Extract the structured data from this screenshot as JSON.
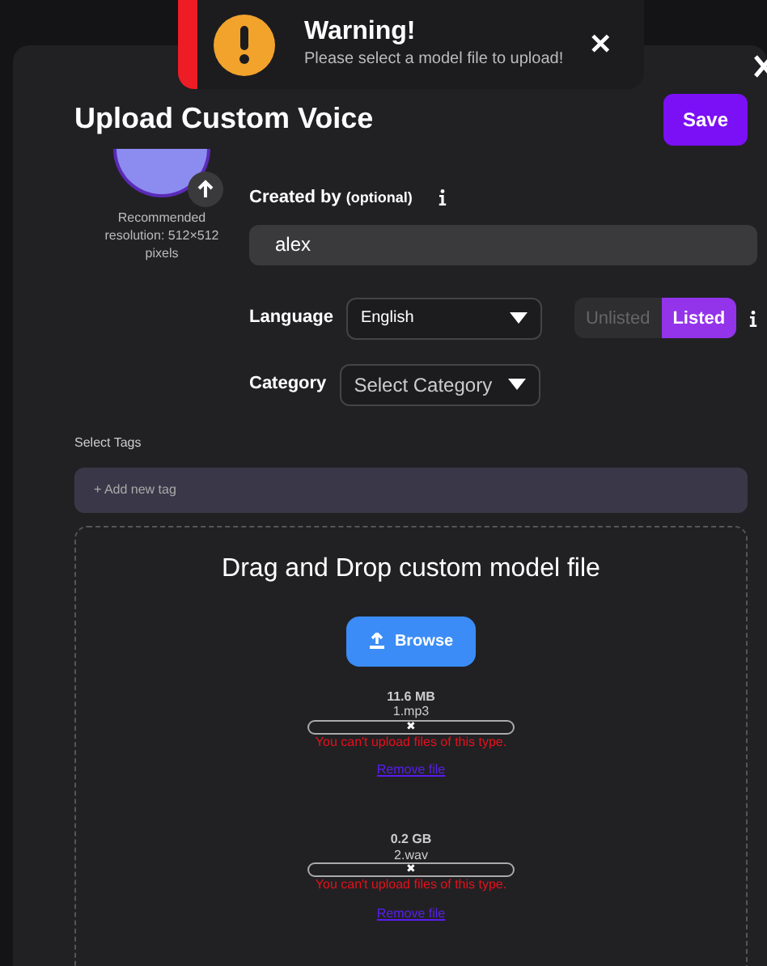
{
  "toast": {
    "title": "Warning!",
    "message": "Please select a model file to upload!",
    "close": "✕"
  },
  "modal": {
    "title": "Upload Custom Voice",
    "save": "Save"
  },
  "avatar": {
    "hint": "Recommended resolution: 512×512 pixels"
  },
  "created_by": {
    "label": "Created by",
    "optional": "(optional)",
    "value": "alex"
  },
  "language": {
    "label": "Language",
    "value": "English"
  },
  "visibility": [
    {
      "label": "Unlisted",
      "selected": false
    },
    {
      "label": "Listed",
      "selected": true
    }
  ],
  "category": {
    "label": "Category",
    "placeholder": "Select Category"
  },
  "tags": {
    "label": "Select Tags",
    "placeholder": "+ Add new tag"
  },
  "dropzone": {
    "title": "Drag and Drop custom model file",
    "browse": "Browse"
  },
  "files": [
    {
      "size": "11.6 MB",
      "name": "1.mp3",
      "status": "✖",
      "level": 0,
      "error": "You can't upload files of this type.",
      "remove": "Remove file"
    },
    {
      "size": "0.2 GB",
      "name": "2.wav",
      "status": "✖",
      "level": 0,
      "error": "You can't upload files of this type.",
      "remove": "Remove file"
    }
  ]
}
